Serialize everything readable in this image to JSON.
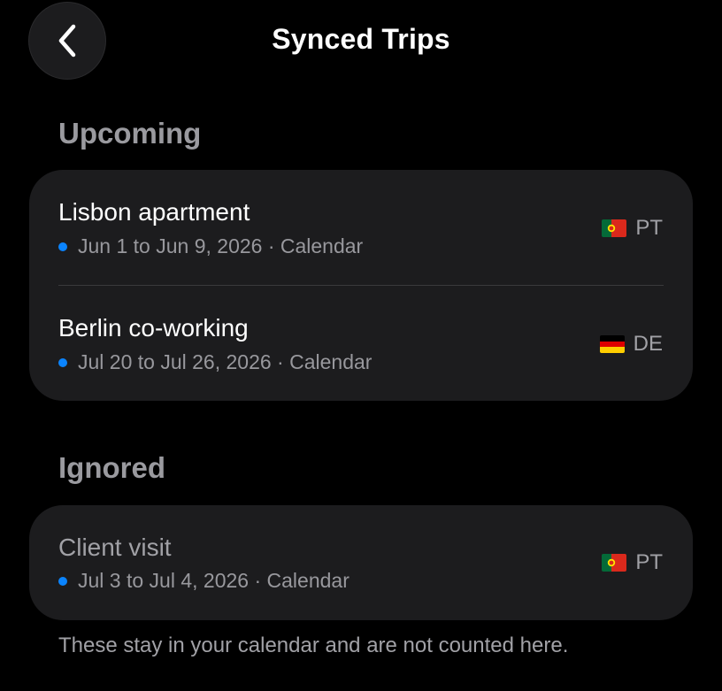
{
  "header": {
    "title": "Synced Trips"
  },
  "upcoming": {
    "header": "Upcoming",
    "trips": [
      {
        "title": "Lisbon apartment",
        "subtitle": "Jun 1 to Jun 9, 2026 · Calendar",
        "country": "PT",
        "flag_icon": "portugal-flag-icon"
      },
      {
        "title": "Berlin co-working",
        "subtitle": "Jul 20 to Jul 26, 2026 · Calendar",
        "country": "DE",
        "flag_icon": "germany-flag-icon"
      }
    ]
  },
  "ignored": {
    "header": "Ignored",
    "trips": [
      {
        "title": "Client visit",
        "subtitle": "Jul 3 to Jul 4, 2026 · Calendar",
        "country": "PT",
        "flag_icon": "portugal-flag-icon"
      }
    ],
    "footnote": "These stay in your calendar and are not counted here."
  },
  "colors": {
    "background": "#000000",
    "card": "#1c1c1e",
    "accent_dot": "#0a84ff",
    "section_header": "#9a9a9f",
    "secondary_text": "#98989d"
  }
}
